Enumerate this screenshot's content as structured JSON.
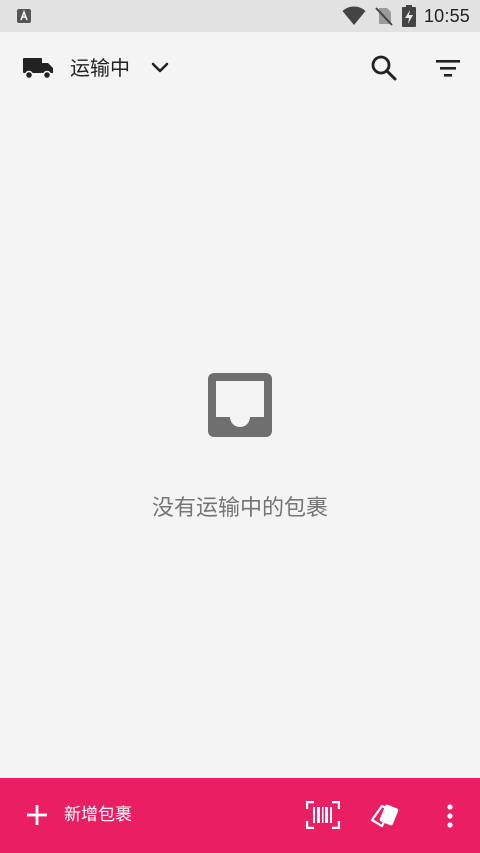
{
  "status_bar": {
    "time": "10:55",
    "left_icon": "app-a-icon",
    "icons": [
      "wifi-icon",
      "no-sim-icon",
      "battery-charging-icon"
    ]
  },
  "toolbar": {
    "leading_icon": "truck-icon",
    "title": "运输中",
    "dropdown_icon": "chevron-down-icon",
    "actions": [
      "search-icon",
      "filter-icon"
    ]
  },
  "empty_state": {
    "icon": "inbox-icon",
    "message": "没有运输中的包裹"
  },
  "bottom_bar": {
    "add_label": "新增包裹",
    "actions": [
      "barcode-scan-icon",
      "tags-icon",
      "more-vert-icon"
    ],
    "background": "#e91e63"
  },
  "colors": {
    "accent": "#e91e63",
    "background": "#f4f4f4",
    "status_bar": "#e2e2e2"
  }
}
